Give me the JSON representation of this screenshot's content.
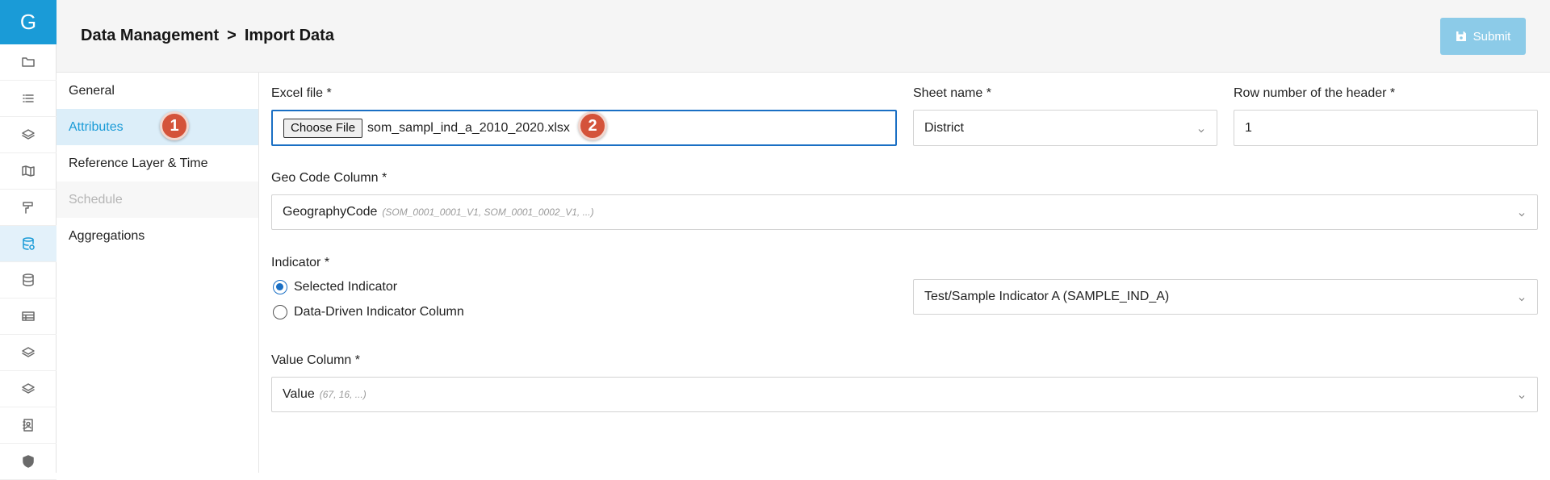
{
  "rail": {
    "logo": "G",
    "icons": [
      "folder-icon",
      "list-icon",
      "layers-icon",
      "map-icon",
      "paint-roller-icon",
      "database-import-icon",
      "database-icon",
      "table-icon",
      "layers-alt-icon",
      "layers-alt2-icon",
      "contact-book-icon",
      "shield-icon"
    ],
    "active_index": 5
  },
  "header": {
    "breadcrumb_parent": "Data Management",
    "breadcrumb_separator": ">",
    "breadcrumb_current": "Import Data",
    "submit_label": "Submit"
  },
  "tabs": [
    {
      "label": "General",
      "state": "normal"
    },
    {
      "label": "Attributes",
      "state": "active"
    },
    {
      "label": "Reference Layer & Time",
      "state": "normal"
    },
    {
      "label": "Schedule",
      "state": "disabled"
    },
    {
      "label": "Aggregations",
      "state": "normal"
    }
  ],
  "badges": {
    "one": "1",
    "two": "2"
  },
  "form": {
    "excel_file": {
      "label": "Excel file *",
      "button": "Choose File",
      "filename": "som_sampl_ind_a_2010_2020.xlsx"
    },
    "sheet_name": {
      "label": "Sheet name *",
      "value": "District"
    },
    "header_row": {
      "label": "Row number of the header *",
      "value": "1"
    },
    "geo_code": {
      "label": "Geo Code Column *",
      "value": "GeographyCode",
      "hint": "(SOM_0001_0001_V1, SOM_0001_0002_V1, ...)"
    },
    "indicator": {
      "label": "Indicator *",
      "options": [
        "Selected Indicator",
        "Data-Driven Indicator Column"
      ],
      "selected_index": 0,
      "value": "Test/Sample Indicator A (SAMPLE_IND_A)"
    },
    "value_column": {
      "label": "Value Column *",
      "value": "Value",
      "hint": "(67, 16, ...)"
    }
  },
  "colors": {
    "accent": "#1a9bd7",
    "badge": "#d4533a",
    "submit": "#8ccbe8"
  }
}
